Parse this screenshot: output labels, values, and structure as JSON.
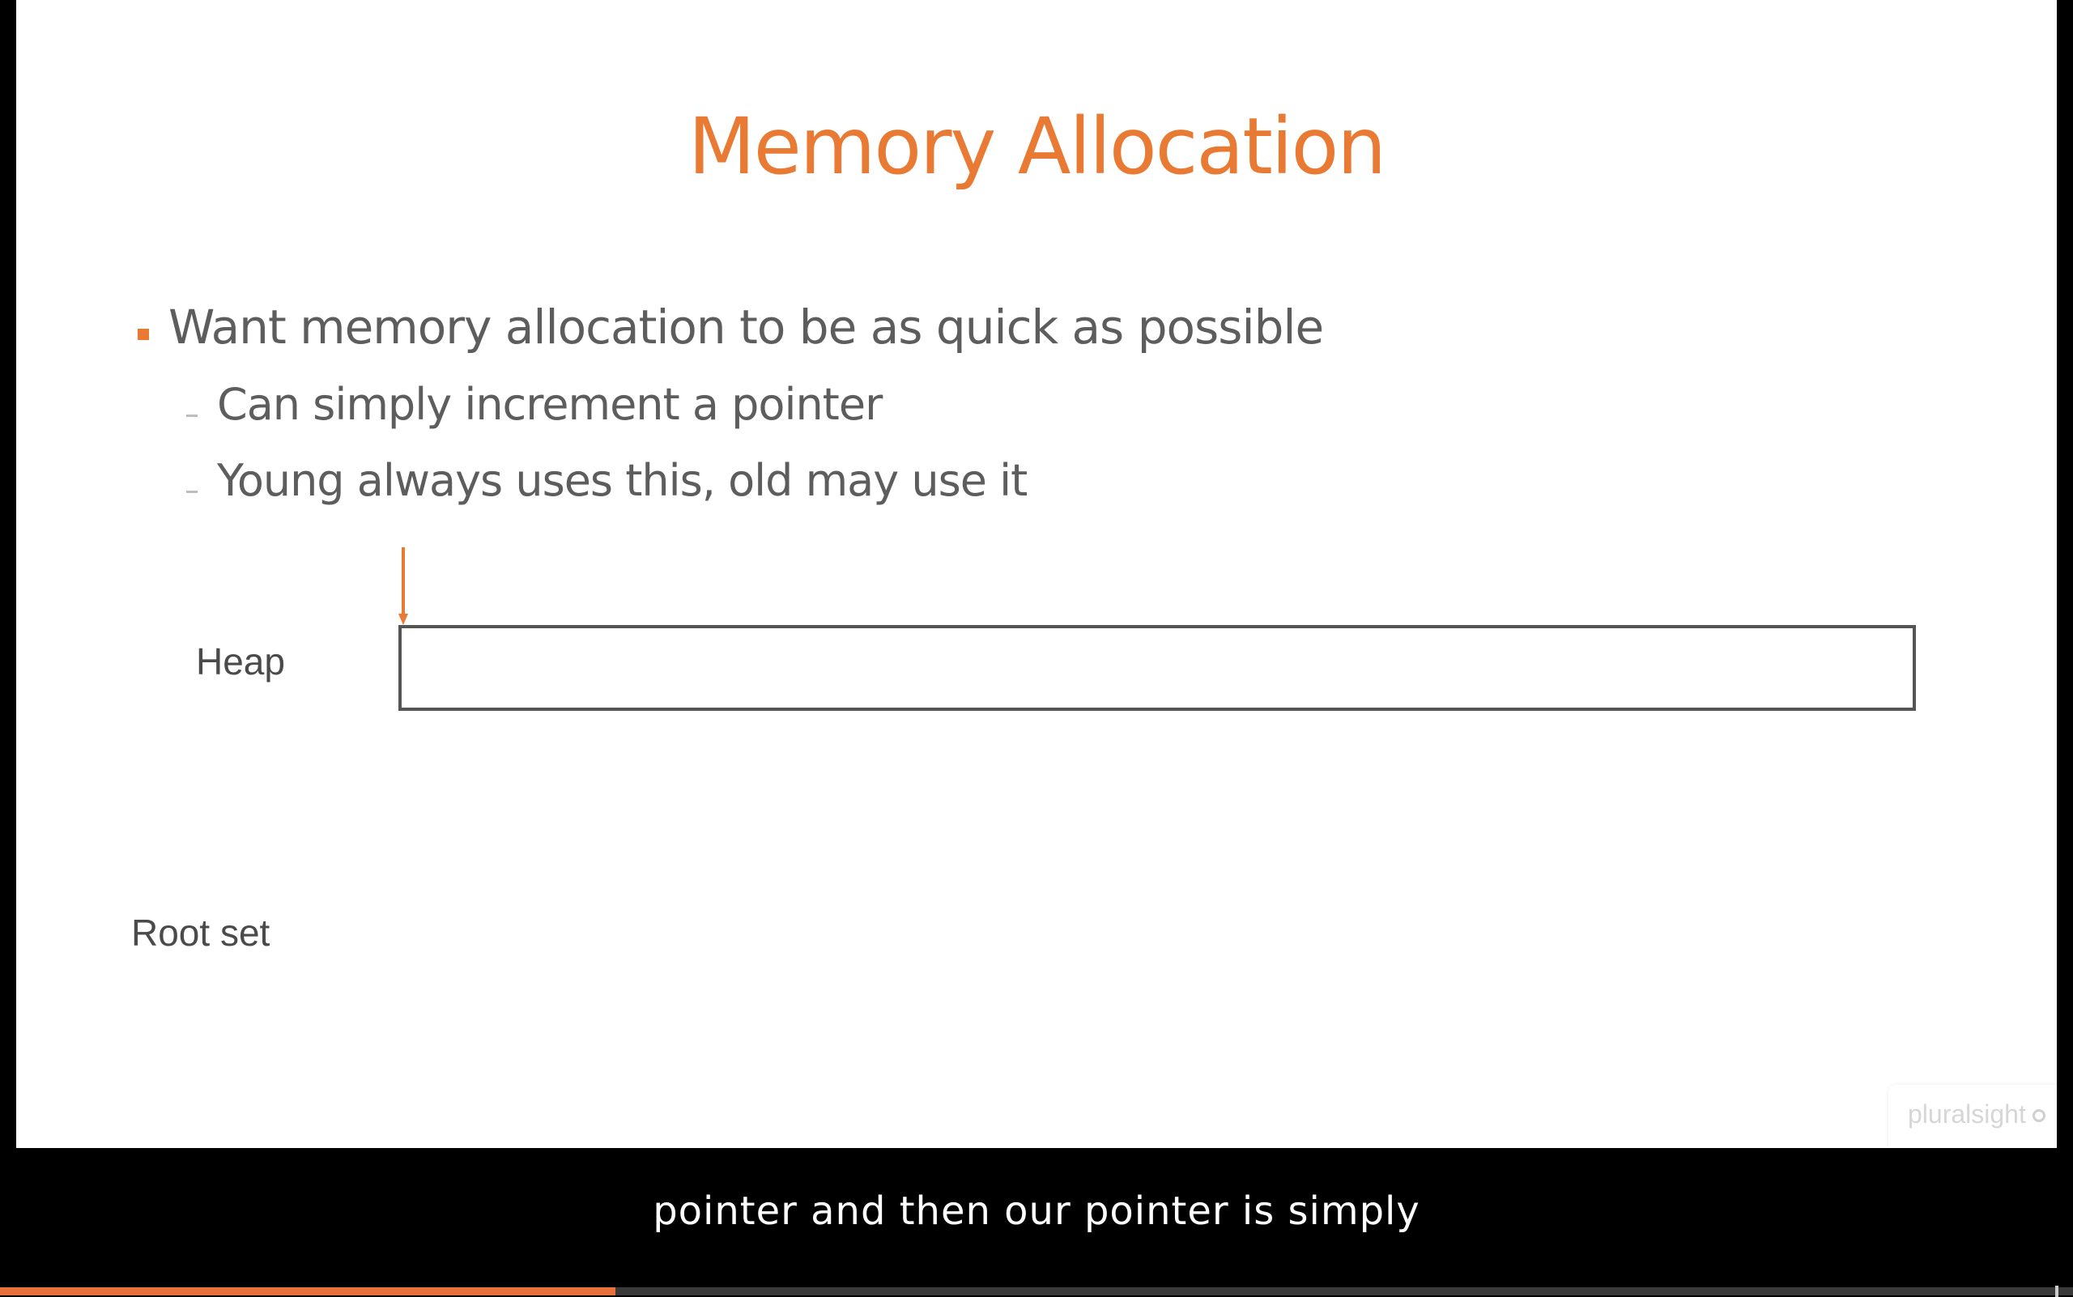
{
  "slide": {
    "title": "Memory Allocation",
    "bullets": [
      {
        "level": 1,
        "text": "Want memory allocation to be as quick as possible"
      },
      {
        "level": 2,
        "text": "Can simply increment a pointer"
      },
      {
        "level": 2,
        "text": "Young always uses this, old may use it"
      }
    ],
    "diagram": {
      "heap_label": "Heap",
      "root_set_label": "Root set"
    },
    "watermark": "pluralsight"
  },
  "player": {
    "caption": "pointer and then our pointer is simply",
    "progress_fraction": 0.297
  },
  "colors": {
    "accent": "#E87A34",
    "text": "#5d5d5d",
    "caption_bg": "#000000",
    "progress": "#E8703A"
  }
}
